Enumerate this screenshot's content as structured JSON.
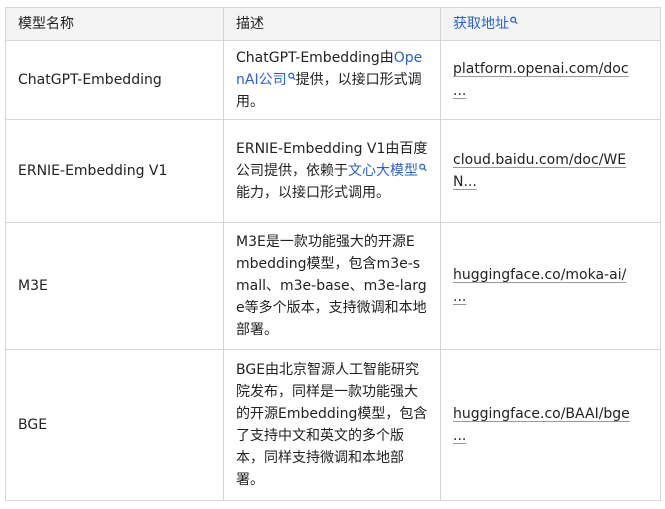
{
  "table": {
    "headers": {
      "name": "模型名称",
      "desc": "描述",
      "source": "获取地址"
    },
    "rows": [
      {
        "name": "ChatGPT-Embedding",
        "desc_pre": "ChatGPT-Embedding由",
        "desc_link": "OpenAI公司",
        "desc_post": "提供，以接口形式调用。",
        "source_line1": "platform.openai.com/doc",
        "source_line2": "..."
      },
      {
        "name": "ERNIE-Embedding V1",
        "desc_pre": "ERNIE-Embedding V1由百度公司提供，依赖于",
        "desc_link": "文心大模型",
        "desc_post": "能力，以接口形式调用。",
        "source_line1": "cloud.baidu.com/doc/WE",
        "source_line2": "N..."
      },
      {
        "name": "M3E",
        "desc": "M3E是一款功能强大的开源Embedding模型，包含m3e-small、m3e-base、m3e-large等多个版本，支持微调和本地部署。",
        "source_line1": "huggingface.co/moka-ai/",
        "source_line2": "..."
      },
      {
        "name": "BGE",
        "desc": "BGE由北京智源人工智能研究院发布，同样是一款功能强大的开源Embedding模型，包含了支持中文和英文的多个版本，同样支持微调和本地部署。",
        "source_line1": "huggingface.co/BAAI/bge",
        "source_line2": "..."
      }
    ]
  }
}
